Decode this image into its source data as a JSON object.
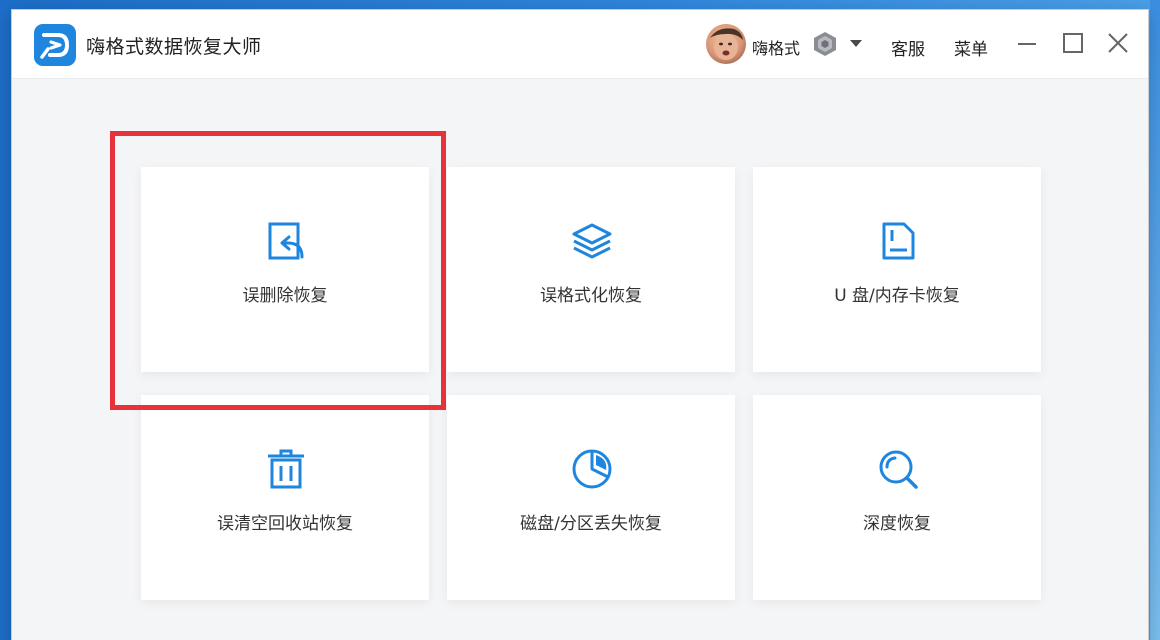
{
  "window": {
    "title": "嗨格式数据恢复大师"
  },
  "user": {
    "name": "嗨格式"
  },
  "header": {
    "service_label": "客服",
    "menu_label": "菜单"
  },
  "colors": {
    "accent": "#1f86e0",
    "highlight": "#e8323a"
  },
  "cards": [
    {
      "label": "误删除恢复",
      "icon": "file-restore-icon"
    },
    {
      "label": "误格式化恢复",
      "icon": "layers-icon"
    },
    {
      "label": "U 盘/内存卡恢复",
      "icon": "sd-card-icon"
    },
    {
      "label": "误清空回收站恢复",
      "icon": "trash-icon"
    },
    {
      "label": "磁盘/分区丢失恢复",
      "icon": "pie-chart-icon"
    },
    {
      "label": "深度恢复",
      "icon": "search-icon"
    }
  ]
}
